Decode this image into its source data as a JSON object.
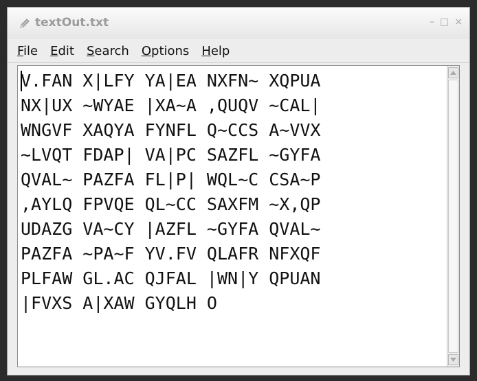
{
  "window": {
    "title": "textOut.txt",
    "controls": [
      "–",
      "□",
      "×"
    ]
  },
  "menubar": {
    "items": [
      {
        "label": "File",
        "mnemonic": "F",
        "rest": "ile"
      },
      {
        "label": "Edit",
        "mnemonic": "E",
        "rest": "dit"
      },
      {
        "label": "Search",
        "mnemonic": "S",
        "rest": "earch"
      },
      {
        "label": "Options",
        "mnemonic": "O",
        "rest": "ptions"
      },
      {
        "label": "Help",
        "mnemonic": "H",
        "rest": "elp"
      }
    ]
  },
  "editor": {
    "content": "V.FAN X|LFY YA|EA NXFN~ XQPUA\nNX|UX ~WYAE |XA~A ,QUQV ~CAL|\nWNGVF XAQYA FYNFL Q~CCS A~VVX\n~LVQT FDAP| VA|PC SAZFL ~GYFA\nQVAL~ PAZFA FL|P| WQL~C CSA~P\n,AYLQ FPVQE QL~CC SAXFM ~X,QP\nUDAZG VA~CY |AZFL ~GYFA QVAL~\nPAZFA ~PA~F YV.FV QLAFR NFXQF\nPLFAW GL.AC QJFAL |WN|Y QPUAN\n|FVXS A|XAW GYQLH O"
  },
  "icons": {
    "title": "pencil-icon",
    "scroll_up": "arrow-up-icon",
    "scroll_down": "arrow-down-icon"
  }
}
